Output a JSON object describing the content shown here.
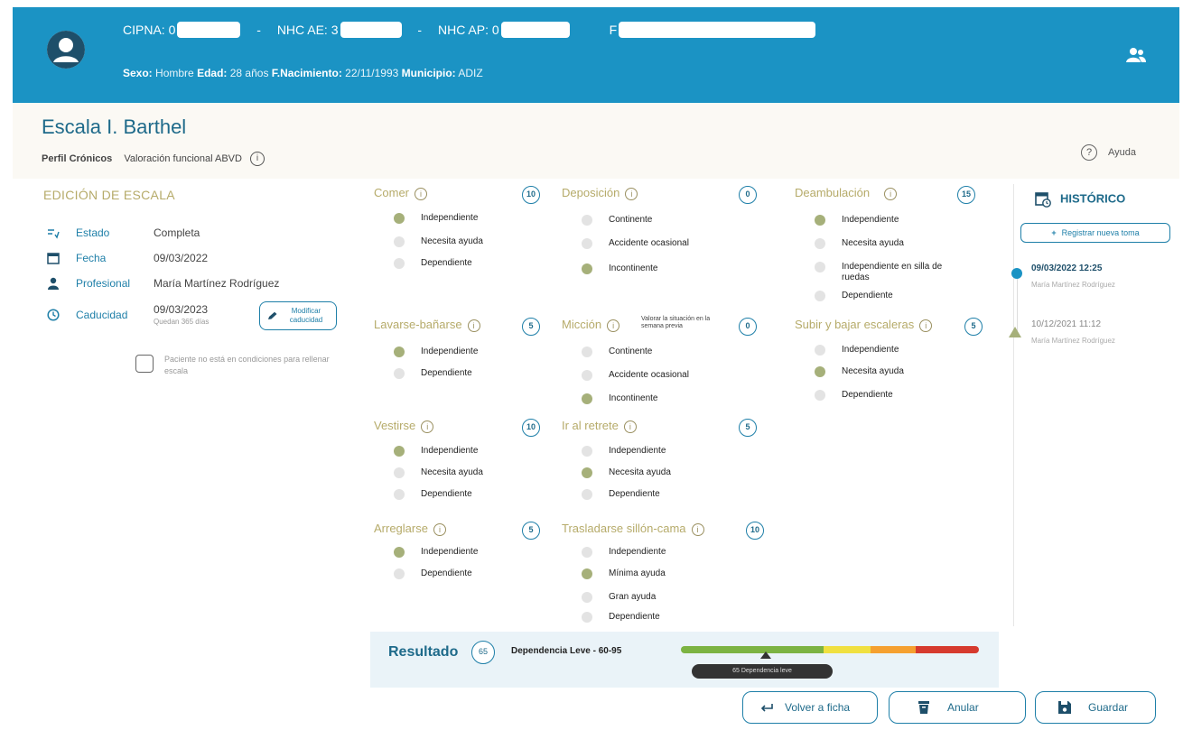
{
  "header": {
    "cipna_label": "CIPNA: 0",
    "nhc_ae_label": "NHC AE: 3",
    "nhc_ap_label": "NHC AP: 0",
    "f_label": "F",
    "sexo_label": "Sexo:",
    "sexo_value": "Hombre",
    "edad_label": "Edad:",
    "edad_value": "28 años",
    "nacimiento_label": "F.Nacimiento:",
    "nacimiento_value": "22/11/1993",
    "municipio_label": "Municipio:",
    "municipio_value": "ADIZ"
  },
  "page": {
    "title": "Escala I. Barthel",
    "perfil": "Perfil Crónicos",
    "valoracion": "Valoración funcional ABVD",
    "help": "Ayuda"
  },
  "edit": {
    "title": "EDICIÓN DE ESCALA",
    "estado_label": "Estado",
    "estado_value": "Completa",
    "fecha_label": "Fecha",
    "fecha_value": "09/03/2022",
    "profesional_label": "Profesional",
    "profesional_value": "María Martínez Rodríguez",
    "caducidad_label": "Caducidad",
    "caducidad_value": "09/03/2023",
    "caducidad_note": "Quedan 365 días",
    "modify_line1": "Modificar",
    "modify_line2": "caducidad",
    "checkbox_label": "Paciente no está en condiciones para rellenar escala"
  },
  "items": {
    "comer": {
      "title": "Comer",
      "score": "10",
      "opts": [
        "Independiente",
        "Necesita ayuda",
        "Dependiente"
      ]
    },
    "deposicion": {
      "title": "Deposición",
      "score": "0",
      "opts": [
        "Continente",
        "Accidente ocasional",
        "Incontinente"
      ]
    },
    "deambulacion": {
      "title": "Deambulación",
      "score": "15",
      "opts": [
        "Independiente",
        "Necesita ayuda",
        "Independiente en silla de ruedas",
        "Dependiente"
      ]
    },
    "lavarse": {
      "title": "Lavarse-bañarse",
      "score": "5",
      "opts": [
        "Independiente",
        "Dependiente"
      ]
    },
    "miccion": {
      "title": "Micción",
      "hint": "Valorar la situación en la semana previa",
      "score": "0",
      "opts": [
        "Continente",
        "Accidente ocasional",
        "Incontinente"
      ]
    },
    "escaleras": {
      "title": "Subir y bajar escaleras",
      "score": "5",
      "opts": [
        "Independiente",
        "Necesita ayuda",
        "Dependiente"
      ]
    },
    "vestirse": {
      "title": "Vestirse",
      "score": "10",
      "opts": [
        "Independiente",
        "Necesita ayuda",
        "Dependiente"
      ]
    },
    "retrete": {
      "title": "Ir al retrete",
      "score": "5",
      "opts": [
        "Independiente",
        "Necesita ayuda",
        "Dependiente"
      ]
    },
    "arreglarse": {
      "title": "Arreglarse",
      "score": "5",
      "opts": [
        "Independiente",
        "Dependiente"
      ]
    },
    "trasladarse": {
      "title": "Trasladarse sillón-cama",
      "score": "10",
      "opts": [
        "Independiente",
        "Mínima ayuda",
        "Gran ayuda",
        "Dependiente"
      ]
    }
  },
  "historico": {
    "title": "HISTÓRICO",
    "register": "Registrar nueva toma",
    "entries": [
      {
        "date": "09/03/2022 12:25",
        "prof": "María Martínez Rodríguez"
      },
      {
        "date": "10/12/2021 11:12",
        "prof": "María Martínez Rodríguez"
      }
    ]
  },
  "result": {
    "label": "Resultado",
    "score": "65",
    "text": "Dependencia Leve - 60-95",
    "tooltip": "65 Dependencia leve"
  },
  "footer": {
    "back": "Volver a ficha",
    "cancel": "Anular",
    "save": "Guardar"
  },
  "colors": {
    "header": "#1b93c4",
    "accent": "#1e7fa8",
    "selected": "#a6b07a",
    "bar_green": "#7cb342",
    "bar_yellow": "#f0e040",
    "bar_orange": "#f5a030",
    "bar_red": "#d63a2e"
  }
}
